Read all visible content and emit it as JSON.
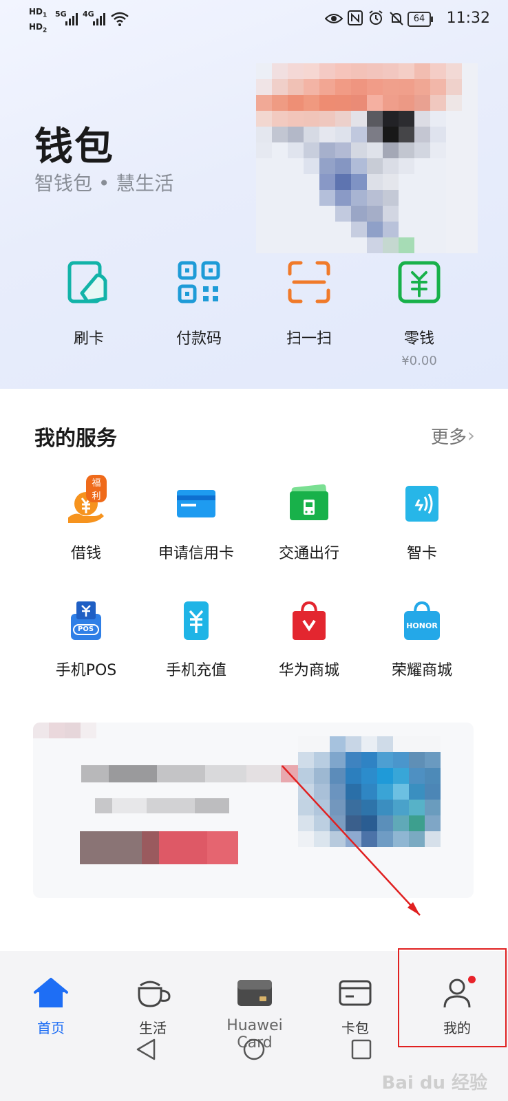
{
  "status_bar": {
    "hd1": "HD",
    "hd1_sub": "1",
    "hd2": "HD",
    "hd2_sub": "2",
    "net1": "5G",
    "net2": "4G",
    "battery": "64",
    "time": "11:32"
  },
  "header": {
    "title": "钱包",
    "subtitle": "智钱包 • 慧生活"
  },
  "quick_actions": [
    {
      "label": "刷卡",
      "icon": "card-swipe-icon",
      "color": "#12b3a8"
    },
    {
      "label": "付款码",
      "icon": "qr-code-icon",
      "color": "#1e9bd7"
    },
    {
      "label": "扫一扫",
      "icon": "scan-icon",
      "color": "#f07a2a"
    },
    {
      "label": "零钱",
      "sub": "¥0.00",
      "icon": "change-wallet-icon",
      "color": "#18b14a"
    }
  ],
  "services": {
    "title": "我的服务",
    "more": "更多",
    "items": [
      {
        "label": "借钱",
        "icon": "loan-icon",
        "badge": "福利"
      },
      {
        "label": "申请信用卡",
        "icon": "credit-card-icon"
      },
      {
        "label": "交通出行",
        "icon": "transit-icon"
      },
      {
        "label": "智卡",
        "icon": "smart-card-icon"
      },
      {
        "label": "手机POS",
        "icon": "pos-icon",
        "icon_text": "POS"
      },
      {
        "label": "手机充值",
        "icon": "phone-recharge-icon"
      },
      {
        "label": "华为商城",
        "icon": "huawei-mall-icon"
      },
      {
        "label": "荣耀商城",
        "icon": "honor-mall-icon",
        "icon_text": "HONOR"
      }
    ]
  },
  "bottom_nav": [
    {
      "label": "首页",
      "icon": "home-icon",
      "active": true
    },
    {
      "label": "生活",
      "icon": "coffee-cup-icon"
    },
    {
      "label": "Huawei Card",
      "icon": "huawei-card-icon"
    },
    {
      "label": "卡包",
      "icon": "card-wallet-icon"
    },
    {
      "label": "我的",
      "icon": "profile-icon",
      "has_dot": true
    }
  ],
  "colors": {
    "accent": "#1e6ef5",
    "annotation": "#e02020"
  },
  "watermark": "Bai du 经验"
}
